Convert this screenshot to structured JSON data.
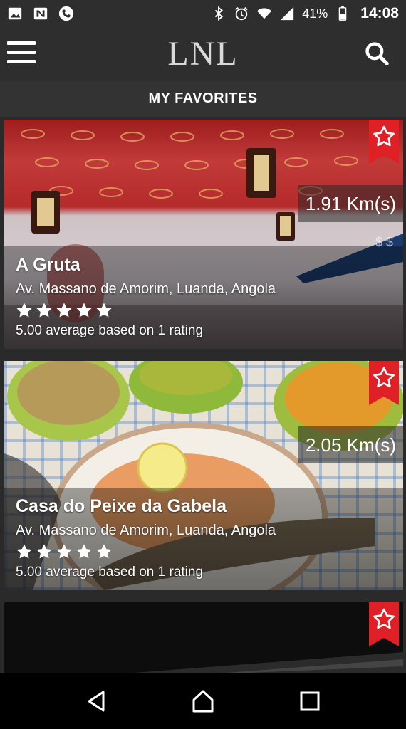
{
  "status_bar": {
    "battery_percent": "41%",
    "time": "14:08",
    "left_icons": [
      "image-icon",
      "n-icon",
      "phone-icon"
    ],
    "right_icons": [
      "bluetooth-icon",
      "alarm-icon",
      "wifi-icon",
      "signal-icon",
      "battery-icon"
    ]
  },
  "app_bar": {
    "logo": "LNL"
  },
  "section": {
    "title": "MY FAVORITES"
  },
  "cards": [
    {
      "name": "A Gruta",
      "address": "Av. Massano de Amorim, Luanda, Angola",
      "rating": 5,
      "rating_text": "5.00 average based on 1 rating",
      "distance": "1.91 Km(s)",
      "price": "$ $",
      "favorited": true
    },
    {
      "name": "Casa do Peixe da Gabela",
      "address": "Av. Massano de Amorim, Luanda, Angola",
      "rating": 5,
      "rating_text": "5.00 average based on 1 rating",
      "distance": "2.05 Km(s)",
      "favorited": true
    },
    {
      "favorited": true
    }
  ],
  "colors": {
    "accent_red": "#e02027",
    "bar_bg": "#2e2e2e"
  }
}
